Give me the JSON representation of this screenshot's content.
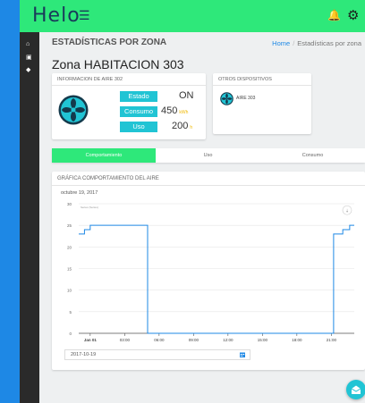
{
  "app": {
    "logo": "Helo",
    "menu_icon": "hamburger-icon"
  },
  "topbar": {
    "icons": [
      "bell-icon",
      "gear-icon"
    ]
  },
  "sidebar": {
    "icons": [
      "home-icon",
      "device-icon",
      "tag-icon"
    ]
  },
  "page": {
    "title": "ESTADÍSTICAS POR ZONA",
    "breadcrumb": {
      "home": "Home",
      "current": "Estadísticas por zona"
    },
    "zone_title": "Zona HABITACION 303"
  },
  "info_card": {
    "title": "INFORMACION DE AIRE 302",
    "rows": [
      {
        "label": "Estado",
        "value": "ON",
        "unit": ""
      },
      {
        "label": "Consumo",
        "value": "450",
        "unit": "kWh"
      },
      {
        "label": "Uso",
        "value": "200",
        "unit": "h"
      }
    ]
  },
  "other_card": {
    "title": "OTROS DISPOSITIVOS",
    "devices": [
      {
        "name": "AIRE 303"
      }
    ]
  },
  "tabs": [
    {
      "label": "Comportamiento",
      "active": true
    },
    {
      "label": "Uso",
      "active": false
    },
    {
      "label": "Consumo",
      "active": false
    }
  ],
  "chart_card": {
    "title": "GRÁFICA COMPORTAMIENTO DEL AIRE",
    "date_label": "octubre 19, 2017",
    "legend": "Series (Series)",
    "date_input": "2017-10-19"
  },
  "chart_data": {
    "type": "line",
    "title": "",
    "xlabel": "",
    "ylabel": "",
    "xlim": [
      0,
      24
    ],
    "ylim": [
      0,
      30
    ],
    "x_ticks": [
      {
        "x": 1,
        "label": "Jan 01"
      },
      {
        "x": 4,
        "label": "03:00"
      },
      {
        "x": 7,
        "label": "06:00"
      },
      {
        "x": 10,
        "label": "09:00"
      },
      {
        "x": 13,
        "label": "12:00"
      },
      {
        "x": 16,
        "label": "15:00"
      },
      {
        "x": 19,
        "label": "18:00"
      },
      {
        "x": 22,
        "label": "21:00"
      }
    ],
    "y_ticks": [
      0,
      5,
      10,
      15,
      20,
      25,
      30
    ],
    "grid": true,
    "series": [
      {
        "name": "Series",
        "step": true,
        "color": "#1e88e5",
        "points": [
          [
            0,
            23
          ],
          [
            0.5,
            24
          ],
          [
            1,
            25
          ],
          [
            6,
            25
          ],
          [
            6,
            0
          ],
          [
            22.2,
            0
          ],
          [
            22.2,
            23
          ],
          [
            23,
            24
          ],
          [
            23.6,
            25
          ],
          [
            24,
            25
          ]
        ]
      }
    ]
  },
  "colors": {
    "accent": "#2ee87a",
    "teal": "#21c4d4",
    "blue": "#1e88e5",
    "unit": "#f0b800"
  }
}
